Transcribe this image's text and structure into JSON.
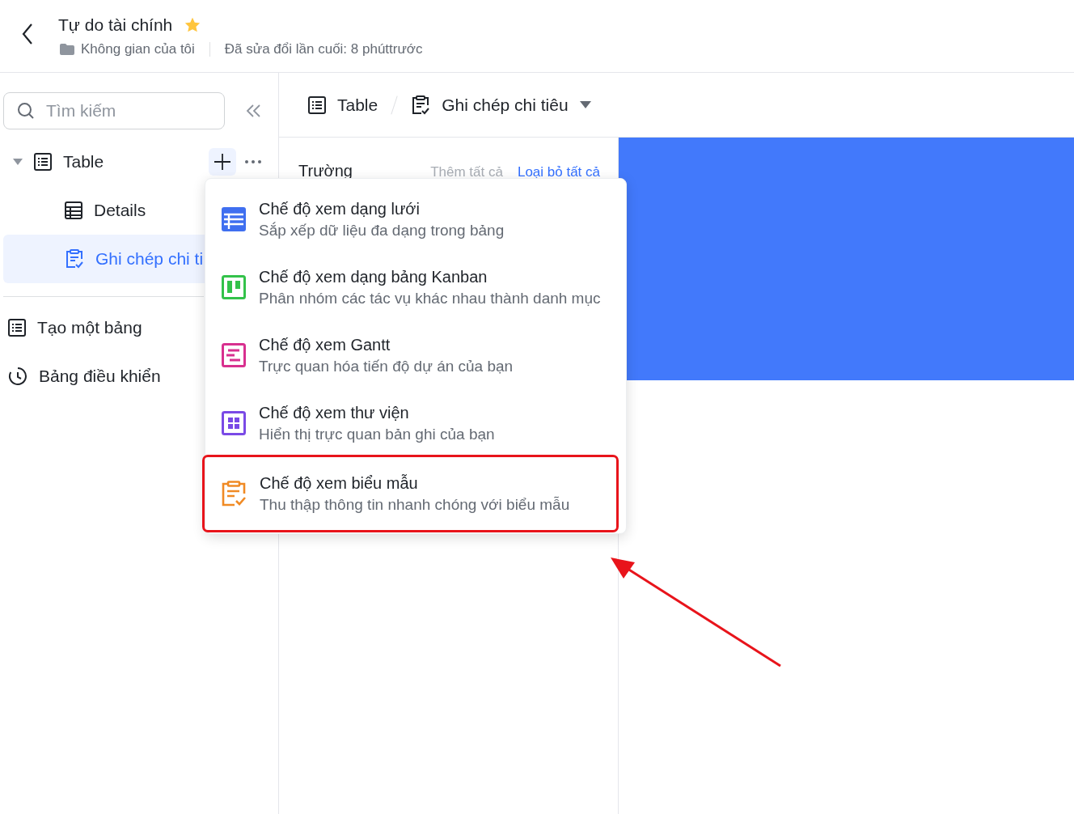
{
  "header": {
    "title": "Tự do tài chính",
    "starred": true,
    "location": "Không gian của tôi",
    "modified": "Đã sửa đổi lần cuối: 8 phúttrước"
  },
  "sidebar": {
    "search": {
      "placeholder": "Tìm kiếm"
    },
    "tree": [
      {
        "label": "Table",
        "kind": "table",
        "expanded": true,
        "selected": false,
        "children": [
          {
            "label": "Details",
            "kind": "grid",
            "selected": false
          },
          {
            "label": "Ghi chép chi ti",
            "kind": "form",
            "selected": true
          }
        ]
      }
    ],
    "items": [
      {
        "label": "Tạo một bảng",
        "kind": "table"
      },
      {
        "label": "Bảng điều khiển",
        "kind": "dashboard"
      }
    ]
  },
  "breadcrumb": [
    {
      "label": "Table",
      "kind": "table"
    },
    {
      "label": "Ghi chép chi tiêu",
      "kind": "form"
    }
  ],
  "fields_panel": {
    "title": "Trường",
    "add_all": "Thêm tất cả",
    "remove_all": "Loại bỏ tất cả"
  },
  "view_menu": [
    {
      "kind": "grid",
      "color": "#3f6ff0",
      "title": "Chế độ xem dạng lưới",
      "subtitle": "Sắp xếp dữ liệu đa dạng trong bảng",
      "highlighted": false
    },
    {
      "kind": "kanban",
      "color": "#33c24a",
      "title": "Chế độ xem dạng bảng Kanban",
      "subtitle": "Phân nhóm các tác vụ khác nhau thành danh mục",
      "highlighted": false
    },
    {
      "kind": "gantt",
      "color": "#d8308f",
      "title": "Chế độ xem Gantt",
      "subtitle": "Trực quan hóa tiến độ dự án của bạn",
      "highlighted": false
    },
    {
      "kind": "gallery",
      "color": "#7a4ae6",
      "title": "Chế độ xem thư viện",
      "subtitle": "Hiển thị trực quan bản ghi của bạn",
      "highlighted": false
    },
    {
      "kind": "form",
      "color": "#f08a24",
      "title": "Chế độ xem biểu mẫu",
      "subtitle": "Thu thập thông tin nhanh chóng với biểu mẫu",
      "highlighted": true
    }
  ]
}
